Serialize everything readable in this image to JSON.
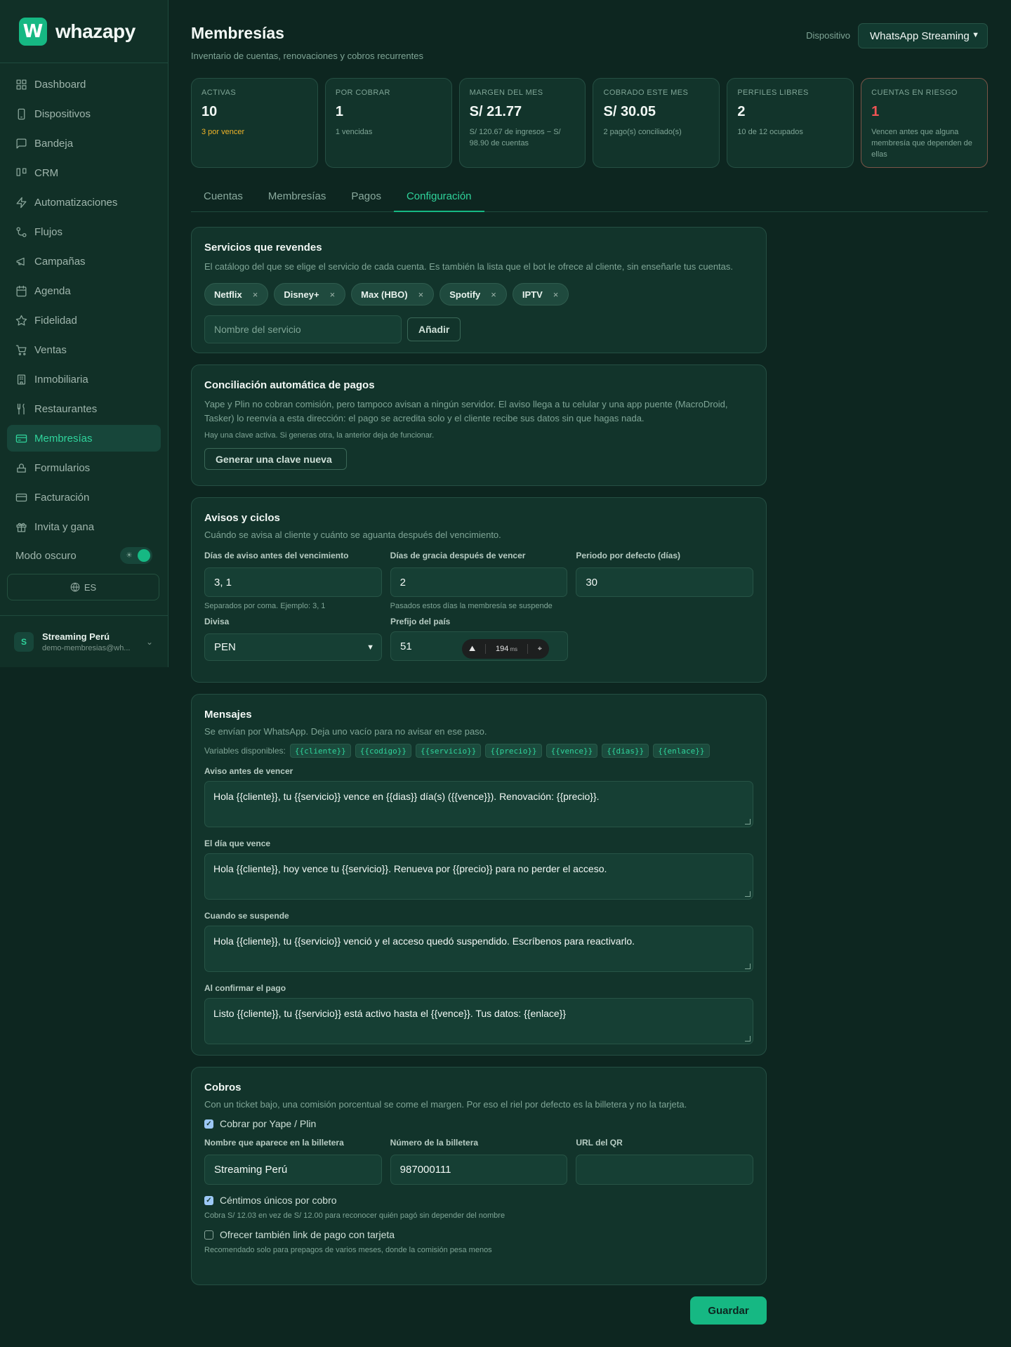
{
  "brand": {
    "name": "whazapy",
    "logo_letter": "W",
    "accent": "#16b883"
  },
  "sidebar": {
    "items": [
      {
        "label": "Dashboard",
        "icon": "grid-icon"
      },
      {
        "label": "Dispositivos",
        "icon": "phone-icon"
      },
      {
        "label": "Bandeja",
        "icon": "chat-icon"
      },
      {
        "label": "CRM",
        "icon": "kanban-icon"
      },
      {
        "label": "Automatizaciones",
        "icon": "bolt-icon"
      },
      {
        "label": "Flujos",
        "icon": "flow-icon"
      },
      {
        "label": "Campañas",
        "icon": "megaphone-icon"
      },
      {
        "label": "Agenda",
        "icon": "calendar-icon"
      },
      {
        "label": "Fidelidad",
        "icon": "star-icon"
      },
      {
        "label": "Ventas",
        "icon": "cart-icon"
      },
      {
        "label": "Inmobiliaria",
        "icon": "building-icon"
      },
      {
        "label": "Restaurantes",
        "icon": "utensils-icon"
      },
      {
        "label": "Membresías",
        "icon": "card-icon",
        "active": true
      },
      {
        "label": "Formularios",
        "icon": "form-icon"
      },
      {
        "label": "Facturación",
        "icon": "invoice-icon"
      },
      {
        "label": "Invita y gana",
        "icon": "gift-icon"
      }
    ],
    "dark_mode_label": "Modo oscuro",
    "dark_mode_on": true,
    "language": "ES",
    "user": {
      "initial": "S",
      "name": "Streaming Perú",
      "email": "demo-membresias@wh..."
    }
  },
  "header": {
    "title": "Membresías",
    "subtitle": "Inventario de cuentas, renovaciones y cobros recurrentes",
    "device_label": "Dispositivo",
    "device_value": "WhatsApp Streaming"
  },
  "stats": [
    {
      "label": "ACTIVAS",
      "value": "10",
      "note": "3 por vencer"
    },
    {
      "label": "POR COBRAR",
      "value": "1",
      "note": "1 vencidas"
    },
    {
      "label": "MARGEN DEL MES",
      "value": "S/ 21.77",
      "note": "S/ 120.67 de ingresos − S/ 98.90 de cuentas"
    },
    {
      "label": "COBRADO ESTE MES",
      "value": "S/ 30.05",
      "note": "2 pago(s) conciliado(s)"
    },
    {
      "label": "PERFILES LIBRES",
      "value": "2",
      "note": "10 de 12 ocupados"
    },
    {
      "label": "CUENTAS EN RIESGO",
      "value": "1",
      "note": "Vencen antes que alguna membresía que dependen de ellas"
    }
  ],
  "tabs": [
    "Cuentas",
    "Membresías",
    "Pagos",
    "Configuración"
  ],
  "active_tab": "Configuración",
  "services": {
    "title": "Servicios que revendes",
    "desc": "El catálogo del que se elige el servicio de cada cuenta. Es también la lista que el bot le ofrece al cliente, sin enseñarle tus cuentas.",
    "chips": [
      "Netflix",
      "Disney+",
      "Max (HBO)",
      "Spotify",
      "IPTV"
    ],
    "remove_glyph": "×",
    "input_placeholder": "Nombre del servicio",
    "add_label": "Añadir"
  },
  "reconcile": {
    "title": "Conciliación automática de pagos",
    "desc": "Yape y Plin no cobran comisión, pero tampoco avisan a ningún servidor. El aviso llega a tu celular y una app puente (MacroDroid, Tasker) lo reenvía a esta dirección: el pago se acredita solo y el cliente recibe sus datos sin que hagas nada.",
    "note": "Hay una clave activa. Si generas otra, la anterior deja de funcionar.",
    "button": "Generar una clave nueva"
  },
  "cycles": {
    "title": "Avisos y ciclos",
    "desc": "Cuándo se avisa al cliente y cuánto se aguanta después del vencimiento.",
    "notice_label": "Días de aviso antes del vencimiento",
    "notice_value": "3, 1",
    "notice_hint": "Separados por coma. Ejemplo: 3, 1",
    "grace_label": "Días de gracia después de vencer",
    "grace_value": "2",
    "grace_hint": "Pasados estos días la membresía se suspende",
    "period_label": "Periodo por defecto (días)",
    "period_value": "30",
    "currency_label": "Divisa",
    "currency_value": "PEN",
    "prefix_label": "Prefijo del país",
    "prefix_value": "51"
  },
  "messages": {
    "title": "Mensajes",
    "desc": "Se envían por WhatsApp. Deja uno vacío para no avisar en ese paso.",
    "vars_label": "Variables disponibles:",
    "vars": [
      "{{cliente}}",
      "{{codigo}}",
      "{{servicio}}",
      "{{precio}}",
      "{{vence}}",
      "{{dias}}",
      "{{enlace}}"
    ],
    "before_label": "Aviso antes de vencer",
    "before_value": "Hola {{cliente}}, tu {{servicio}} vence en {{dias}} día(s) ({{vence}}). Renovación: {{precio}}.",
    "due_label": "El día que vence",
    "due_value": "Hola {{cliente}}, hoy vence tu {{servicio}}. Renueva por {{precio}} para no perder el acceso.",
    "suspend_label": "Cuando se suspende",
    "suspend_value": "Hola {{cliente}}, tu {{servicio}} venció y el acceso quedó suspendido. Escríbenos para reactivarlo.",
    "paid_label": "Al confirmar el pago",
    "paid_value": "Listo {{cliente}}, tu {{servicio}} está activo hasta el {{vence}}. Tus datos: {{enlace}}"
  },
  "billing": {
    "title": "Cobros",
    "desc": "Con un ticket bajo, una comisión porcentual se come el margen. Por eso el riel por defecto es la billetera y no la tarjeta.",
    "yape_label": "Cobrar por Yape / Plin",
    "yape_checked": true,
    "wallet_name_label": "Nombre que aparece en la billetera",
    "wallet_name_value": "Streaming Perú",
    "wallet_number_label": "Número de la billetera",
    "wallet_number_value": "987000111",
    "qr_label": "URL del QR",
    "qr_value": "",
    "cents_label": "Céntimos únicos por cobro",
    "cents_checked": true,
    "cents_hint": "Cobra S/ 12.03 en vez de S/ 12.00 para reconocer quién pagó sin depender del nombre",
    "card_label": "Ofrecer también link de pago con tarjeta",
    "card_checked": false,
    "card_hint": "Recomendado solo para prepagos de varios meses, donde la comisión pesa menos"
  },
  "save_label": "Guardar",
  "dev_overlay": {
    "ms_value": "194",
    "ms_unit": "ms"
  }
}
